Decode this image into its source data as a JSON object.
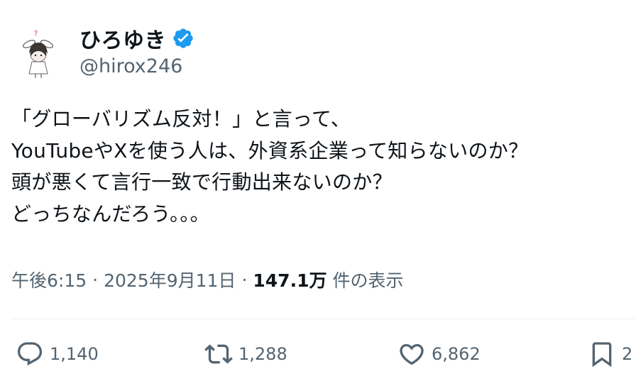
{
  "user": {
    "display_name": "ひろゆき",
    "handle": "@hirox246",
    "verified_icon": "verified-badge-icon",
    "verified_color": "#1d9bf0"
  },
  "tweet": {
    "lines": [
      "「グローバリズム反対！」と言って、",
      "YouTubeやXを使う人は、外資系企業って知らないのか？",
      "頭が悪くて言行一致で行動出来ないのか？",
      "どっちなんだろう。。。"
    ]
  },
  "meta": {
    "time": "午後6:15",
    "separator": "·",
    "date": "2025年9月11日",
    "views_count": "147.1万",
    "views_label": "件の表示"
  },
  "actions": {
    "reply": {
      "icon": "reply-icon",
      "count": "1,140"
    },
    "retweet": {
      "icon": "retweet-icon",
      "count": "1,288"
    },
    "like": {
      "icon": "heart-icon",
      "count": "6,862"
    },
    "bookmark": {
      "icon": "bookmark-icon",
      "count": "2"
    }
  },
  "colors": {
    "text": "#0f1419",
    "secondary": "#536471",
    "accent": "#1d9bf0"
  }
}
